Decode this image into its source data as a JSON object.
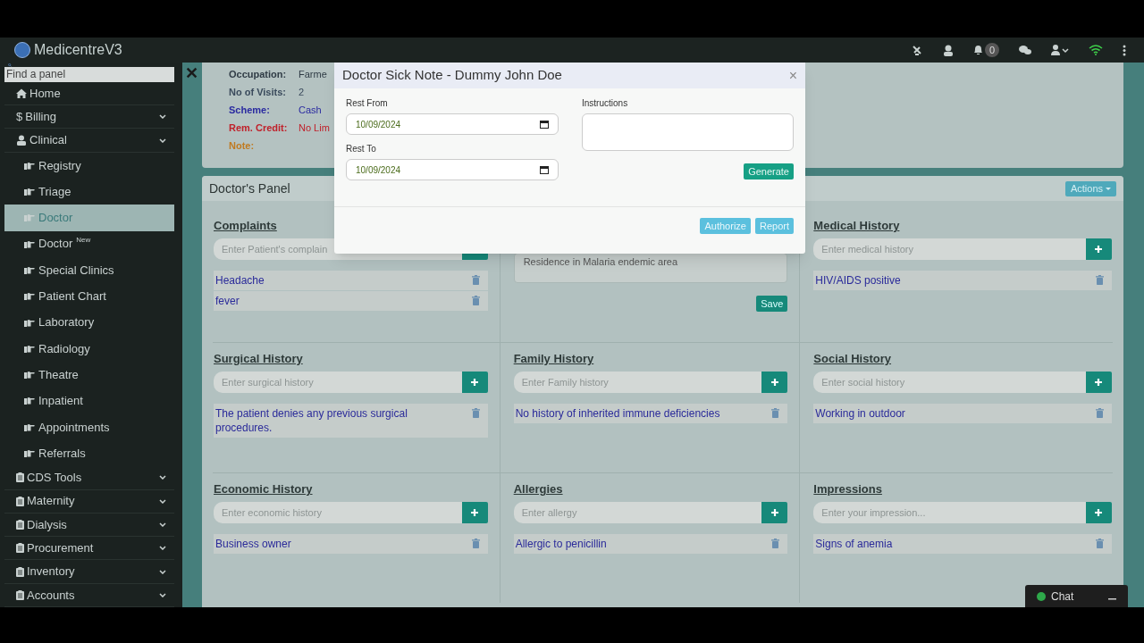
{
  "app": {
    "title": "MedicentreV3"
  },
  "topbar": {
    "notification_count": "0"
  },
  "sidebar": {
    "search_placeholder": "Find a panel",
    "items": [
      {
        "label": "Home",
        "expandable": false,
        "selected": false
      },
      {
        "label": "Billing",
        "icon_text": "$",
        "expandable": true,
        "selected": false
      },
      {
        "label": "Clinical",
        "expandable": true,
        "selected": false,
        "children": [
          {
            "label": "Registry",
            "selected": false
          },
          {
            "label": "Triage",
            "selected": false
          },
          {
            "label": "Doctor",
            "selected": true
          },
          {
            "label": "Doctor",
            "badge": "New",
            "selected": false
          },
          {
            "label": "Special Clinics",
            "selected": false
          },
          {
            "label": "Patient Chart",
            "selected": false
          },
          {
            "label": "Laboratory",
            "selected": false
          },
          {
            "label": "Radiology",
            "selected": false
          },
          {
            "label": "Theatre",
            "selected": false
          },
          {
            "label": "Inpatient",
            "selected": false
          },
          {
            "label": "Appointments",
            "selected": false
          },
          {
            "label": "Referrals",
            "selected": false
          }
        ]
      },
      {
        "label": "CDS Tools",
        "expandable": true,
        "selected": false
      },
      {
        "label": "Maternity",
        "expandable": true,
        "selected": false
      },
      {
        "label": "Dialysis",
        "expandable": true,
        "selected": false
      },
      {
        "label": "Procurement",
        "expandable": true,
        "selected": false
      },
      {
        "label": "Inventory",
        "expandable": true,
        "selected": false
      },
      {
        "label": "Accounts",
        "expandable": true,
        "selected": false
      }
    ]
  },
  "close_panel": "✕",
  "patient_info": [
    {
      "label": "Occupation:",
      "value": "Farme",
      "color": "#2f3b45"
    },
    {
      "label": "No of Visits:",
      "value": "2",
      "color": "#3a4a5c"
    },
    {
      "label": "Scheme:",
      "value": "Cash",
      "color": "#2a2aa0"
    },
    {
      "label": "Rem. Credit:",
      "value": "No Lim",
      "color": "#c0202a"
    },
    {
      "label": "Note:",
      "color": "#c07a20"
    }
  ],
  "panel": {
    "title": "Doctor's Panel",
    "actions": "Actions"
  },
  "sections": [
    {
      "kind": "list",
      "title": "Complaints",
      "placeholder": "Enter Patient's complain",
      "entries": [
        "Headache",
        "fever"
      ]
    },
    {
      "kind": "notes",
      "value": "Residence in Malaria endemic area",
      "button": "Save"
    },
    {
      "kind": "list",
      "title": "Medical History",
      "placeholder": "Enter medical history",
      "entries": [
        "HIV/AIDS positive"
      ]
    },
    {
      "kind": "list",
      "title": "Surgical History",
      "placeholder": "Enter surgical history",
      "entries": [
        "The patient denies any previous surgical procedures."
      ]
    },
    {
      "kind": "list",
      "title": "Family History",
      "placeholder": "Enter Family history",
      "entries": [
        "No history of inherited immune deficiencies"
      ]
    },
    {
      "kind": "list",
      "title": "Social History",
      "placeholder": "Enter social history",
      "entries": [
        "Working in outdoor"
      ]
    },
    {
      "kind": "list",
      "title": "Economic History",
      "placeholder": "Enter economic history",
      "entries": [
        "Business owner"
      ]
    },
    {
      "kind": "list",
      "title": "Allergies",
      "placeholder": "Enter allergy",
      "entries": [
        "Allergic to penicillin"
      ]
    },
    {
      "kind": "list",
      "title": "Impressions",
      "placeholder": "Enter your impression...",
      "entries": [
        "Signs of anemia"
      ]
    }
  ],
  "modal": {
    "title": "Doctor Sick Note - Dummy John Doe",
    "close": "×",
    "rest_from": {
      "label": "Rest From",
      "value": "10/09/2024"
    },
    "rest_to": {
      "label": "Rest To",
      "value": "10/09/2024"
    },
    "instructions": {
      "label": "Instructions"
    },
    "generate": "Generate",
    "authorize": "Authorize",
    "report": "Report"
  },
  "chat": {
    "label": "Chat",
    "online": true
  }
}
